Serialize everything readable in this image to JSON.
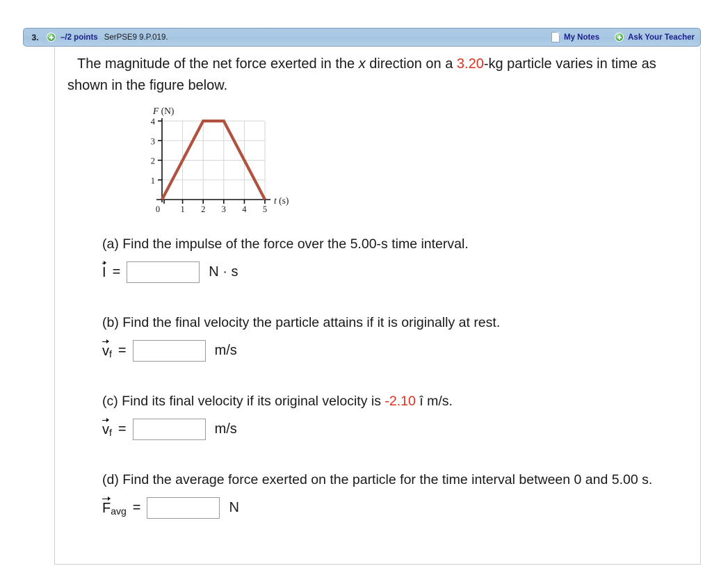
{
  "header": {
    "question_number": "3.",
    "plus_icon": "plus-circle-icon",
    "points": "–/2 points",
    "assignment_code": "SerPSE9 9.P.019.",
    "note_icon": "page-icon",
    "my_notes_label": "My Notes",
    "ask_plus_icon": "plus-circle-icon",
    "ask_teacher_label": "Ask Your Teacher",
    "bar_color": "#a9c8e3",
    "link_color": "#1e1e8c"
  },
  "stem": {
    "part1": "The magnitude of the net force exerted in the ",
    "var_x": "x",
    "part2": " direction on a ",
    "mass": "3.20",
    "part3": "-kg particle varies in time as shown in the figure below."
  },
  "chart_data": {
    "type": "line",
    "title": "",
    "xlabel": "t (s)",
    "ylabel": "F (N)",
    "xlim": [
      0,
      5
    ],
    "ylim": [
      0,
      4
    ],
    "xticks": [
      "0",
      "1",
      "2",
      "3",
      "4",
      "5"
    ],
    "yticks": [
      "1",
      "2",
      "3",
      "4"
    ],
    "grid": true,
    "line_color": "#b0523f",
    "grid_color": "#d5d5d5",
    "axis_color": "#111111",
    "series": [
      {
        "name": "F(t)",
        "x": [
          0,
          2,
          3,
          5
        ],
        "values": [
          0,
          4,
          4,
          0
        ]
      }
    ],
    "annotations": []
  },
  "parts": [
    {
      "id": "a",
      "text": "(a) Find the impulse of the force over the 5.00-s time interval.",
      "symbol": "I",
      "subscript": "",
      "vector": true,
      "equals": "=",
      "answer_value": "",
      "unit": "N · s"
    },
    {
      "id": "b",
      "text": "(b) Find the final velocity the particle attains if it is originally at rest.",
      "symbol": "v",
      "subscript": "f",
      "vector": true,
      "equals": "=",
      "answer_value": "",
      "unit": "m/s"
    },
    {
      "id": "c",
      "text_before": "(c) Find its final velocity if its original velocity is ",
      "highlight": "-2.10",
      "text_after": " î m/s.",
      "symbol": "v",
      "subscript": "f",
      "vector": true,
      "equals": "=",
      "answer_value": "",
      "unit": "m/s"
    },
    {
      "id": "d",
      "text": "(d) Find the average force exerted on the particle for the time interval between 0 and 5.00 s.",
      "symbol": "F",
      "subscript": "avg",
      "vector": true,
      "equals": "=",
      "answer_value": "",
      "unit": "N"
    }
  ]
}
